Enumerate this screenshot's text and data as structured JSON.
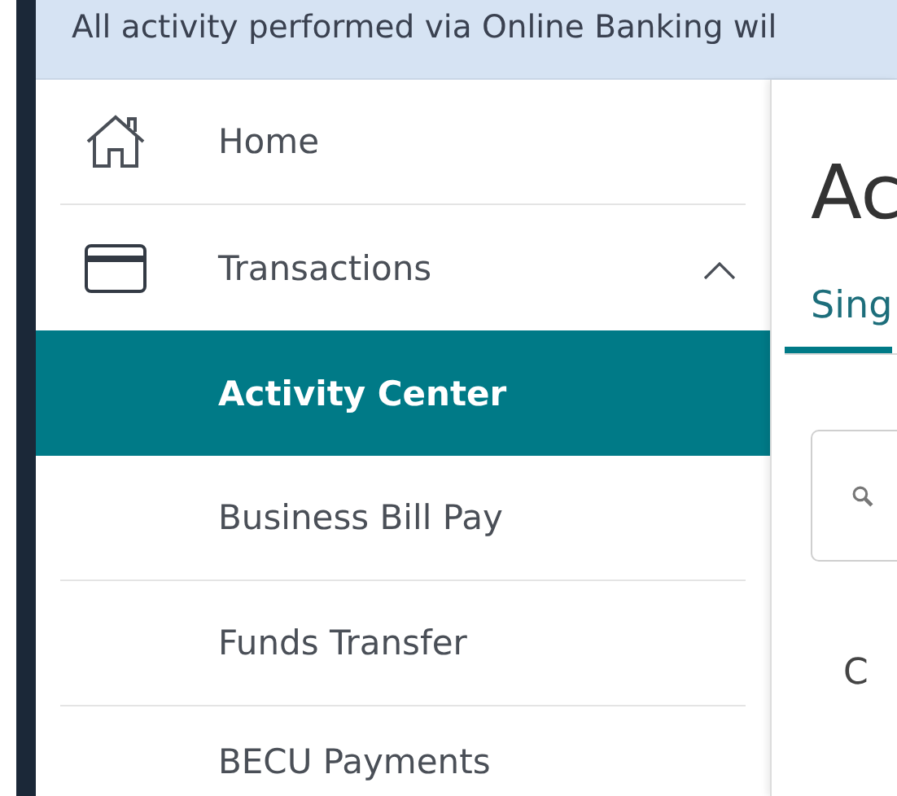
{
  "banner": {
    "text": "All activity performed via Online Banking wil"
  },
  "sidebar": {
    "items": [
      {
        "label": "Home",
        "selected": false
      },
      {
        "label": "Transactions",
        "selected": false,
        "expanded": true,
        "children": [
          {
            "label": "Activity Center",
            "selected": true
          },
          {
            "label": "Business Bill Pay",
            "selected": false
          },
          {
            "label": "Funds Transfer",
            "selected": false
          },
          {
            "label": "BECU Payments",
            "selected": false
          }
        ]
      }
    ]
  },
  "content": {
    "heading": "Ac",
    "tabs": [
      {
        "label": "Sing",
        "selected": true
      }
    ],
    "section_label": "C"
  }
}
